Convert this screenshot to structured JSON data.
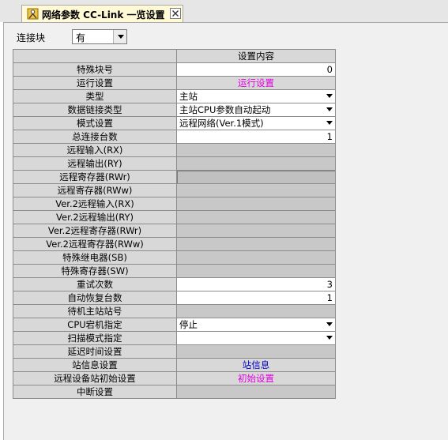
{
  "tab": {
    "title": "网络参数  CC-Link 一览设置",
    "close_glyph": "×"
  },
  "connection": {
    "label": "连接块",
    "value": "有"
  },
  "grid": {
    "header": "设置内容",
    "rows": [
      {
        "label": "特殊块号",
        "value": "0",
        "kind": "input"
      },
      {
        "label": "运行设置",
        "value": "运行设置",
        "kind": "btn",
        "color": "#e000e0"
      },
      {
        "label": "类型",
        "value": "主站",
        "kind": "select"
      },
      {
        "label": "数据链接类型",
        "value": "主站CPU参数自动起动",
        "kind": "select"
      },
      {
        "label": "模式设置",
        "value": "远程网络(Ver.1模式)",
        "kind": "select"
      },
      {
        "label": "总连接台数",
        "value": "1",
        "kind": "input"
      },
      {
        "label": "远程输入(RX)",
        "value": "",
        "kind": "disabled"
      },
      {
        "label": "远程输出(RY)",
        "value": "",
        "kind": "disabled"
      },
      {
        "label": "远程寄存器(RWr)",
        "value": "",
        "kind": "sunken"
      },
      {
        "label": "远程寄存器(RWw)",
        "value": "",
        "kind": "disabled"
      },
      {
        "label": "Ver.2远程输入(RX)",
        "value": "",
        "kind": "disabled"
      },
      {
        "label": "Ver.2远程输出(RY)",
        "value": "",
        "kind": "disabled"
      },
      {
        "label": "Ver.2远程寄存器(RWr)",
        "value": "",
        "kind": "disabled"
      },
      {
        "label": "Ver.2远程寄存器(RWw)",
        "value": "",
        "kind": "disabled"
      },
      {
        "label": "特殊继电器(SB)",
        "value": "",
        "kind": "disabled"
      },
      {
        "label": "特殊寄存器(SW)",
        "value": "",
        "kind": "disabled"
      },
      {
        "label": "重试次数",
        "value": "3",
        "kind": "input"
      },
      {
        "label": "自动恢复台数",
        "value": "1",
        "kind": "input"
      },
      {
        "label": "待机主站站号",
        "value": "",
        "kind": "disabled"
      },
      {
        "label": "CPU宕机指定",
        "value": "停止",
        "kind": "select"
      },
      {
        "label": "扫描模式指定",
        "value": "",
        "kind": "select"
      },
      {
        "label": "延迟时间设置",
        "value": "",
        "kind": "disabled"
      },
      {
        "label": "站信息设置",
        "value": "站信息",
        "kind": "btn",
        "color": "#0000cc"
      },
      {
        "label": "远程设备站初始设置",
        "value": "初始设置",
        "kind": "btn",
        "color": "#e000e0"
      },
      {
        "label": "中断设置",
        "value": "",
        "kind": "disabled"
      }
    ]
  }
}
